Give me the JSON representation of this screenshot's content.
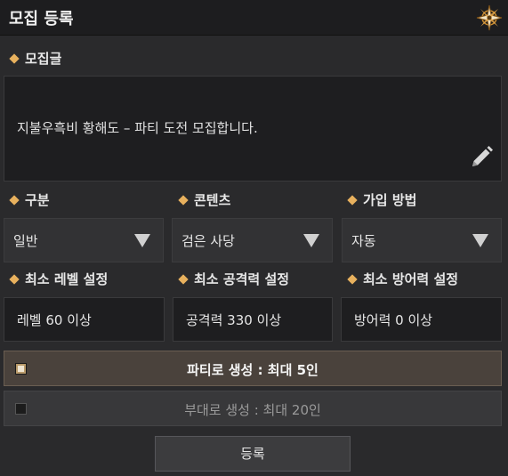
{
  "window": {
    "title": "모집 등록",
    "close_icon": "compass-star-close-icon"
  },
  "post": {
    "label": "모집글",
    "text": "지불우흑비 황해도 – 파티 도전 모집합니다.",
    "edit_icon": "pencil-icon"
  },
  "filters": [
    {
      "label": "구분",
      "value": "일반"
    },
    {
      "label": "콘텐츠",
      "value": "검은 사당"
    },
    {
      "label": "가입 방법",
      "value": "자동"
    }
  ],
  "requirements": [
    {
      "label": "최소 레벨 설정",
      "value": "레벨  60 이상"
    },
    {
      "label": "최소 공격력 설정",
      "value": "공격력  330 이상"
    },
    {
      "label": "최소 방어력 설정",
      "value": "방어력  0 이상"
    }
  ],
  "group_options": [
    {
      "label": "파티로 생성 : 최대 5인",
      "checked": true
    },
    {
      "label": "부대로 생성 : 최대 20인",
      "checked": false
    }
  ],
  "submit_label": "등록",
  "colors": {
    "accent": "#e8b15e",
    "background": "#2a2a2c",
    "header": "#1d1d1f"
  }
}
